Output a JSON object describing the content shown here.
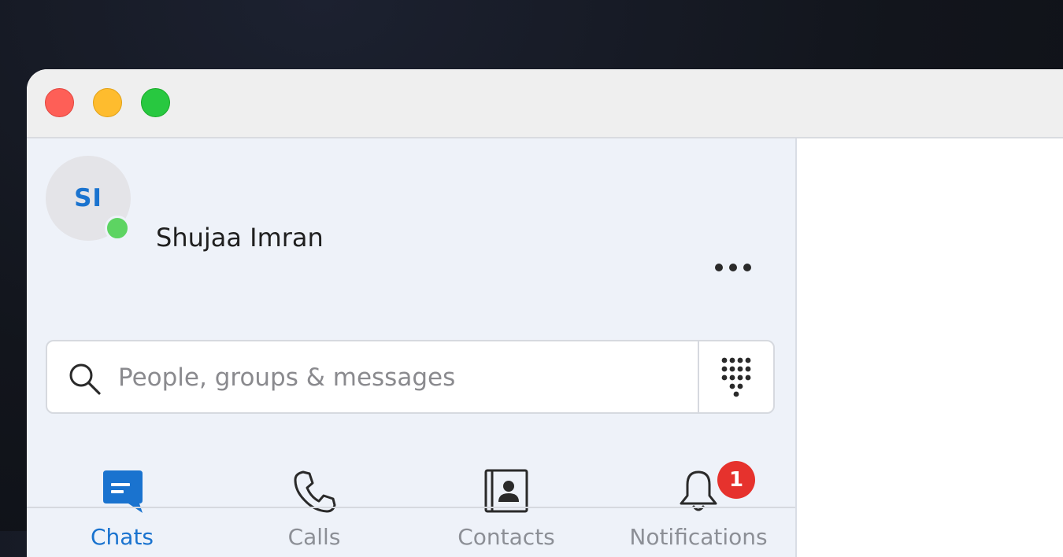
{
  "window": {
    "controls": [
      "close",
      "minimize",
      "maximize"
    ],
    "colors": {
      "close": "#fe5f57",
      "minimize": "#febc2e",
      "maximize": "#28c840"
    }
  },
  "profile": {
    "initials": "SI",
    "name": "Shujaa Imran",
    "status": "online",
    "status_color": "#5dd462"
  },
  "search": {
    "placeholder": "People, groups & messages",
    "value": "",
    "icon": "search-icon",
    "dialpad_icon": "dialpad-icon"
  },
  "nav": {
    "items": [
      {
        "label": "Chats",
        "icon": "chat-icon",
        "active": true
      },
      {
        "label": "Calls",
        "icon": "phone-icon",
        "active": false
      },
      {
        "label": "Contacts",
        "icon": "contacts-icon",
        "active": false
      },
      {
        "label": "Notifications",
        "icon": "bell-icon",
        "active": false,
        "badge": "1"
      }
    ],
    "accent_color": "#1a73cf",
    "badge_color": "#e6322d"
  }
}
